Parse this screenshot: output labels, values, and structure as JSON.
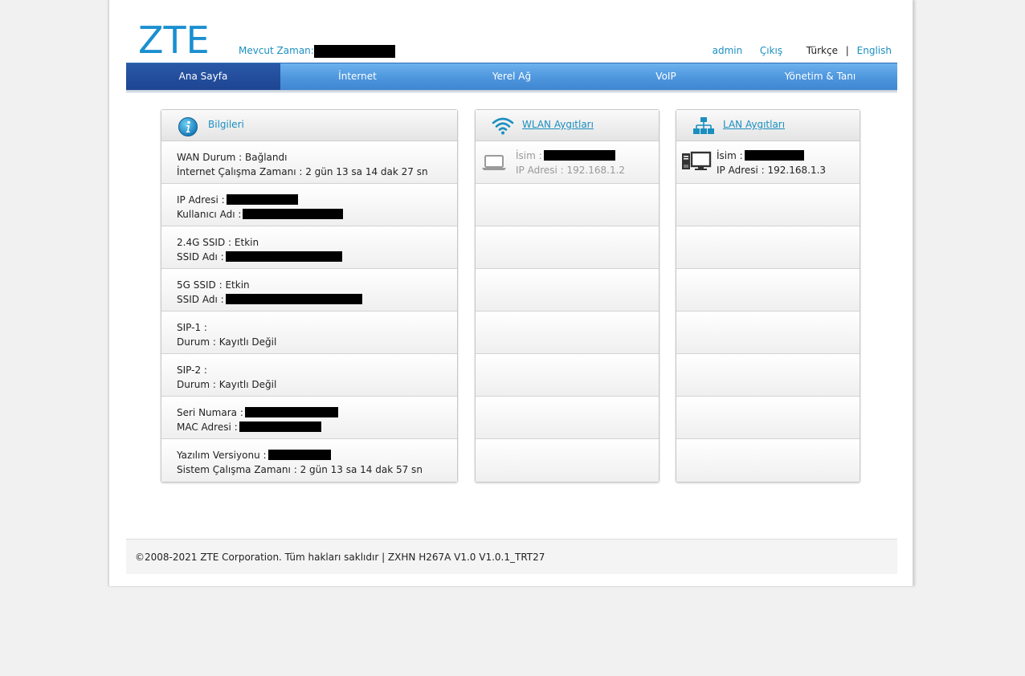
{
  "header": {
    "logo_text": "ZTE",
    "time_label": "Mevcut Zaman:",
    "links": {
      "user": "admin",
      "logout": "Çıkış",
      "lang_current": "Türkçe",
      "lang_sep": "|",
      "lang_other": "English"
    }
  },
  "nav": {
    "items": [
      {
        "label": "Ana Sayfa",
        "active": true
      },
      {
        "label": "İnternet"
      },
      {
        "label": "Yerel Ağ"
      },
      {
        "label": "VoIP"
      },
      {
        "label": "Yönetim & Tanı"
      }
    ]
  },
  "info": {
    "title": "Bilgileri",
    "rows": [
      {
        "k1": "WAN Durum",
        "v1": "Bağlandı",
        "k2": "İnternet Çalışma Zamanı",
        "v2": "2 gün 13 sa 14 dak 27 sn"
      },
      {
        "k1": "IP Adresi",
        "v1": "",
        "k2": "Kullanıcı Adı",
        "v2": ""
      },
      {
        "k1": "2.4G SSID",
        "v1": "Etkin",
        "k2": "SSID Adı",
        "v2": ""
      },
      {
        "k1": "5G SSID",
        "v1": "Etkin",
        "k2": "SSID Adı",
        "v2": ""
      },
      {
        "k1": "SIP-1",
        "v1": "",
        "k2": "Durum",
        "v2": "Kayıtlı Değil"
      },
      {
        "k1": "SIP-2",
        "v1": "",
        "k2": "Durum",
        "v2": "Kayıtlı Değil"
      },
      {
        "k1": "Seri Numara",
        "v1": "",
        "k2": "MAC Adresi",
        "v2": ""
      },
      {
        "k1": "Yazılım Versiyonu",
        "v1": "",
        "k2": "Sistem Çalışma Zamanı",
        "v2": "2 gün 13 sa 14 dak 57 sn"
      }
    ],
    "sep": " :"
  },
  "wlan": {
    "title": "WLAN Aygıtları",
    "device": {
      "name_label": "İsim",
      "ip_label": "IP Adresi",
      "ip": "192.168.1.2"
    }
  },
  "lan": {
    "title": "LAN Aygıtları",
    "device": {
      "name_label": "İsim",
      "ip_label": "IP Adresi",
      "ip": "192.168.1.3"
    }
  },
  "footer": {
    "text": "©2008-2021 ZTE Corporation. Tüm hakları saklıdır  |   ZXHN H267A V1.0 V1.0.1_TRT27"
  }
}
